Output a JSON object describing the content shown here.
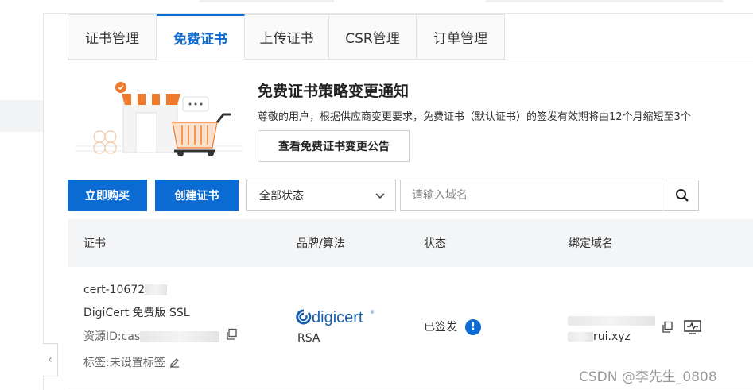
{
  "tabs": [
    {
      "label": "证书管理",
      "active": false
    },
    {
      "label": "免费证书",
      "active": true
    },
    {
      "label": "上传证书",
      "active": false
    },
    {
      "label": "CSR管理",
      "active": false
    },
    {
      "label": "订单管理",
      "active": false
    }
  ],
  "notice": {
    "title": "免费证书策略变更通知",
    "description": "尊敬的用户，根据供应商变更要求，免费证书（默认证书）的签发有效期将由12个月缩短至3个",
    "button_label": "查看免费证书变更公告"
  },
  "toolbar": {
    "buy_label": "立即购买",
    "create_label": "创建证书",
    "status_select_value": "全部状态",
    "search_placeholder": "请输入域名"
  },
  "table": {
    "headers": {
      "cert": "证书",
      "brand": "品牌/算法",
      "status": "状态",
      "domain": "绑定域名"
    },
    "rows": [
      {
        "cert_id": "cert-10672",
        "cert_name": "DigiCert 免费版 SSL",
        "resource_id_label": "资源ID:cas",
        "tags_label": "标签:未设置标签",
        "brand_logo": "digicert",
        "algorithm": "RSA",
        "status": "已签发",
        "domain_suffix": "rui.xyz"
      }
    ]
  },
  "watermark": "CSDN @李先生_0808",
  "colors": {
    "accent": "#0b6bd3",
    "logo_blue": "#1a5fa8",
    "illus_orange": "#f07a2a"
  }
}
